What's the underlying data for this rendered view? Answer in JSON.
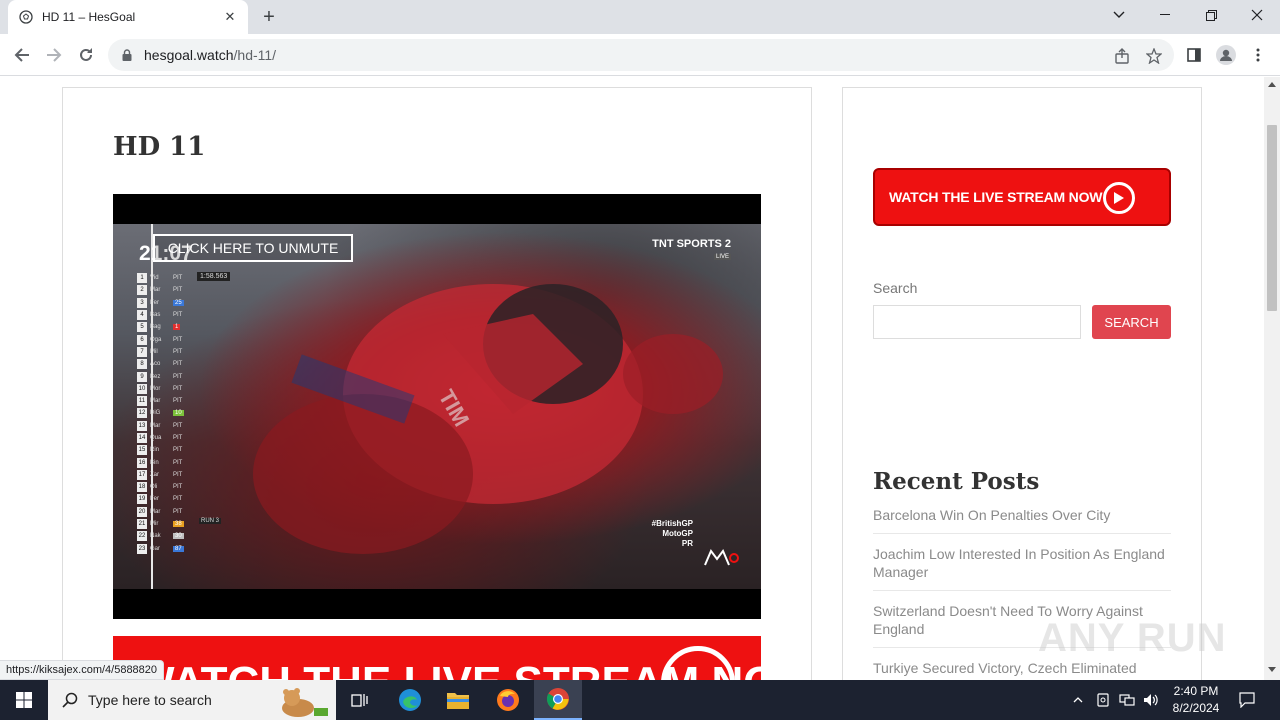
{
  "browser": {
    "tab_title": "HD 11 – HesGoal",
    "url_host": "hesgoal.watch",
    "url_path": "/hd-11/"
  },
  "page": {
    "post_title": "HD 11",
    "video": {
      "unmute_label": "CLICK HERE TO UNMUTE",
      "timer": "21:07",
      "broadcaster": "TNT SPORTS 2",
      "broadcaster_badge": "LIVE",
      "lap_time": "1:58.563",
      "hashtag": "#BritishGP",
      "hashtag_sub1": "MotoGP",
      "hashtag_sub2": "PR",
      "leaderboard": [
        {
          "pos": "1",
          "name": "Vid",
          "stat": "PIT"
        },
        {
          "pos": "2",
          "name": "Mar",
          "stat": "PIT"
        },
        {
          "pos": "3",
          "name": "Fer",
          "stat": "25"
        },
        {
          "pos": "4",
          "name": "Bas",
          "stat": "PIT"
        },
        {
          "pos": "5",
          "name": "Bag",
          "stat": "1"
        },
        {
          "pos": "6",
          "name": "Oga",
          "stat": "PIT"
        },
        {
          "pos": "7",
          "name": "Mil",
          "stat": "PIT"
        },
        {
          "pos": "8",
          "name": "Aco",
          "stat": "PIT"
        },
        {
          "pos": "9",
          "name": "Bez",
          "stat": "PIT"
        },
        {
          "pos": "10",
          "name": "Mor",
          "stat": "PIT"
        },
        {
          "pos": "11",
          "name": "Mar",
          "stat": "PIT"
        },
        {
          "pos": "12",
          "name": "DiG",
          "stat": "10"
        },
        {
          "pos": "13",
          "name": "Mar",
          "stat": "PIT"
        },
        {
          "pos": "14",
          "name": "Qua",
          "stat": "PIT"
        },
        {
          "pos": "15",
          "name": "Rin",
          "stat": "PIT"
        },
        {
          "pos": "16",
          "name": "Bin",
          "stat": "PIT"
        },
        {
          "pos": "17",
          "name": "Zar",
          "stat": "PIT"
        },
        {
          "pos": "18",
          "name": "Oli",
          "stat": "PIT"
        },
        {
          "pos": "19",
          "name": "Fer",
          "stat": "PIT"
        },
        {
          "pos": "20",
          "name": "Mar",
          "stat": "PIT"
        },
        {
          "pos": "21",
          "name": "Mir",
          "stat": "38"
        },
        {
          "pos": "22",
          "name": "Nak",
          "stat": "30"
        },
        {
          "pos": "23",
          "name": "Gar",
          "stat": "87"
        }
      ],
      "run_label": "RUN 3"
    },
    "banner_text": "WATCH THE LIVE STREAM NOW"
  },
  "sidebar": {
    "watch_button": "WATCH THE LIVE STREAM NOW",
    "search_label": "Search",
    "search_button": "SEARCH",
    "recent_title": "Recent Posts",
    "recent_posts": [
      "Barcelona Win On Penalties Over City",
      "Joachim Low Interested In Position As England Manager",
      "Switzerland Doesn't Need To Worry Against England",
      "Turkiye Secured Victory, Czech Eliminated"
    ]
  },
  "status_bar_url": "https://kiksajex.com/4/5888820",
  "watermark": "ANY RUN",
  "taskbar": {
    "search_placeholder": "Type here to search",
    "time": "2:40 PM",
    "date": "8/2/2024"
  },
  "colors": {
    "accent_red": "#ee1111",
    "search_button": "#e0454f",
    "taskbar": "#1c2230"
  }
}
